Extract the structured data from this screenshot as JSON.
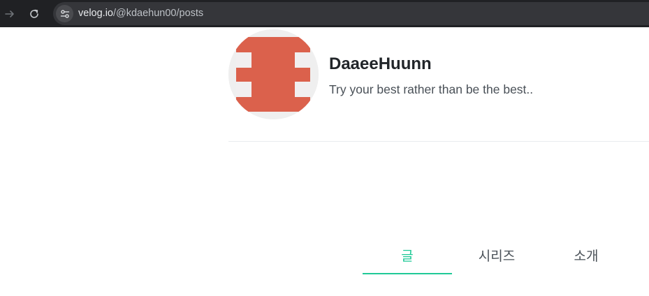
{
  "browser": {
    "url_host": "velog.io",
    "url_path": "/@kdaehun00/posts",
    "icons": {
      "forward": "arrow-right-icon",
      "reload": "reload-icon",
      "site_info": "tune-icon"
    }
  },
  "profile": {
    "name": "DaaeeHuunn",
    "bio": "Try your best rather than be the best..",
    "avatar_colors": {
      "background": "#efefef",
      "stripe": "#db614c",
      "light": "#f1eff0"
    }
  },
  "tabs": [
    {
      "label": "글",
      "active": true
    },
    {
      "label": "시리즈",
      "active": false
    },
    {
      "label": "소개",
      "active": false
    }
  ],
  "colors": {
    "accent": "#20c997",
    "text": "#212529",
    "subtext": "#495057"
  }
}
